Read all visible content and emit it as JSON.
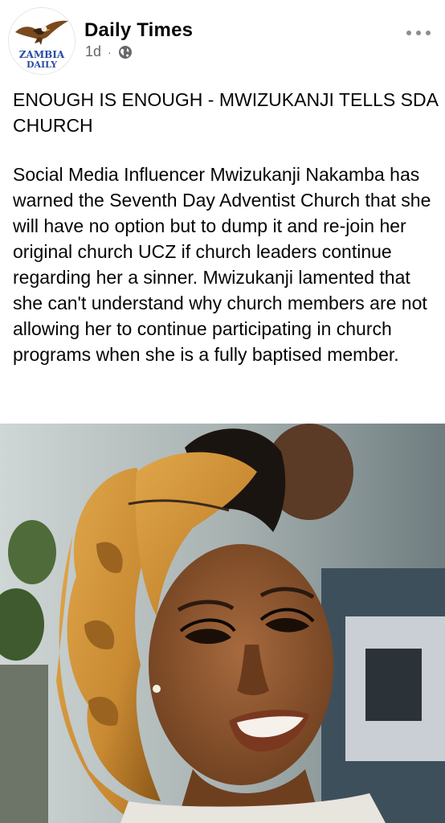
{
  "post": {
    "page_name": "Daily Times",
    "avatar_text_line1": "ZAMBIA",
    "avatar_text_line2": "DAILY",
    "timestamp": "1d",
    "separator": "·",
    "privacy_icon": "globe-icon",
    "more_icon": "more-options-icon",
    "headline": "ENOUGH IS ENOUGH - MWIZUKANJI TELLS SDA CHURCH",
    "body": "Social Media Influencer Mwizukanji Nakamba has warned the Seventh Day Adventist Church that she will have no option but to dump it and re-join her original church UCZ if church leaders continue regarding her a sinner. Mwizukanji lamented that she can't understand why church members are not allowing her to continue participating in church programs when she is a fully baptised member."
  },
  "colors": {
    "text_primary": "#050505",
    "text_secondary": "#65676b",
    "avatar_text": "#2a4aa8",
    "hair": "#c98a32"
  }
}
